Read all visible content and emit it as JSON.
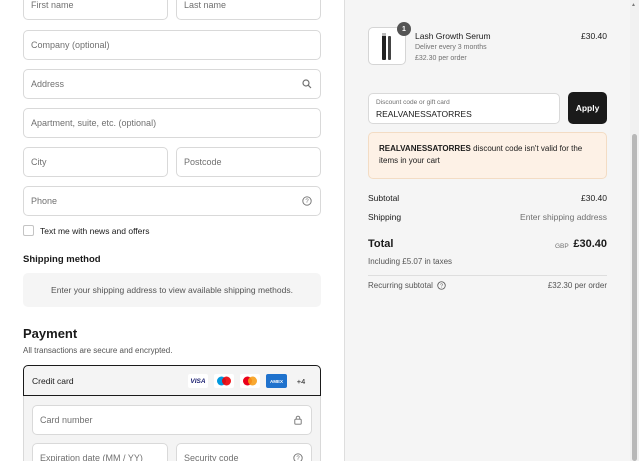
{
  "form": {
    "first_name_placeholder": "First name",
    "last_name_placeholder": "Last name",
    "company_placeholder": "Company (optional)",
    "address_placeholder": "Address",
    "apartment_placeholder": "Apartment, suite, etc. (optional)",
    "city_placeholder": "City",
    "postcode_placeholder": "Postcode",
    "phone_placeholder": "Phone",
    "text_me_label": "Text me with news and offers"
  },
  "shipping": {
    "heading": "Shipping method",
    "message": "Enter your shipping address to view available shipping methods."
  },
  "payment": {
    "heading": "Payment",
    "subtitle": "All transactions are secure and encrypted.",
    "method_label": "Credit card",
    "brands": [
      "VISA",
      "Maestro",
      "Mastercard",
      "AMEX"
    ],
    "more_brands": "+4",
    "card_number_placeholder": "Card number",
    "expiration_placeholder": "Expiration date (MM / YY)",
    "security_code_placeholder": "Security code"
  },
  "summary": {
    "item": {
      "quantity": "1",
      "name": "Lash Growth Serum",
      "frequency": "Deliver every 3 months",
      "per_order": "£32.30 per order",
      "price": "£30.40"
    },
    "discount": {
      "label": "Discount code or gift card",
      "value": "REALVANESSATORRES",
      "apply_label": "Apply",
      "error_code": "REALVANESSATORRES",
      "error_text": " discount code isn't valid for the items in your cart"
    },
    "subtotal_label": "Subtotal",
    "subtotal_value": "£30.40",
    "shipping_label": "Shipping",
    "shipping_value": "Enter shipping address",
    "total_label": "Total",
    "total_currency": "GBP",
    "total_value": "£30.40",
    "taxes_text": "Including £5.07 in taxes",
    "recurring_label": "Recurring subtotal",
    "recurring_value": "£32.30 per order"
  },
  "colors": {
    "accent": "#1a1a1a",
    "error_bg": "#fdf1e6",
    "summary_bg": "#f5f5f5"
  }
}
